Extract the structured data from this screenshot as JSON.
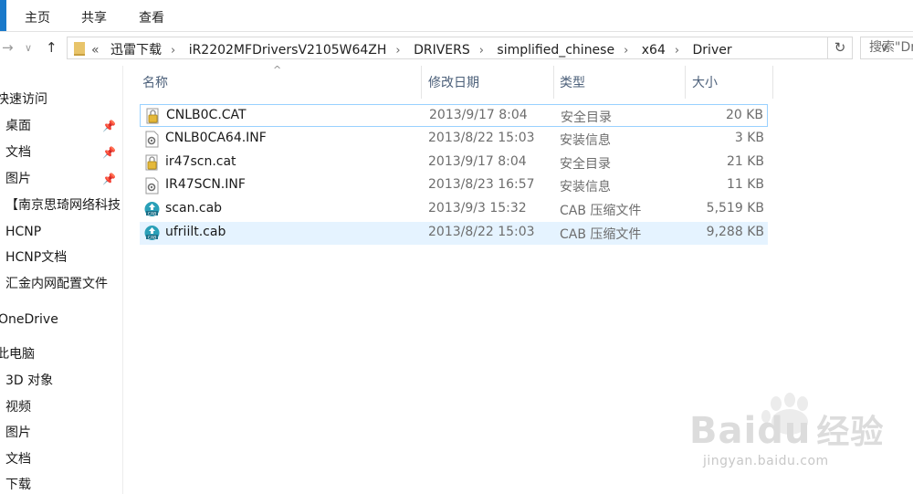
{
  "ribbon": {
    "tabs": [
      "主页",
      "共享",
      "查看"
    ]
  },
  "addressbar": {
    "back_icon": "back-arrow-icon",
    "forward_icon": "forward-arrow-icon",
    "up_icon": "up-arrow-icon",
    "overflow": "«",
    "crumbs": [
      "迅雷下载",
      "iR2202MFDriversV2105W64ZH",
      "DRIVERS",
      "simplified_chinese",
      "x64",
      "Driver"
    ],
    "search_placeholder": "搜索\"Driver\""
  },
  "sidebar": {
    "items": [
      {
        "label": "快速访问",
        "pinned": false
      },
      {
        "label": "桌面",
        "pinned": true
      },
      {
        "label": "文档",
        "pinned": true
      },
      {
        "label": "图片",
        "pinned": true
      },
      {
        "label": "【南京思琦网络科技",
        "pinned": false
      },
      {
        "label": "HCNP",
        "pinned": false
      },
      {
        "label": "HCNP文档",
        "pinned": false
      },
      {
        "label": "汇金内网配置文件",
        "pinned": false
      },
      {
        "label": "OneDrive",
        "pinned": false
      },
      {
        "label": "此电脑",
        "pinned": false
      },
      {
        "label": "3D 对象",
        "pinned": false
      },
      {
        "label": "视频",
        "pinned": false
      },
      {
        "label": "图片",
        "pinned": false
      },
      {
        "label": "文档",
        "pinned": false
      },
      {
        "label": "下载",
        "pinned": false
      }
    ]
  },
  "filelist": {
    "columns": [
      "名称",
      "修改日期",
      "类型",
      "大小"
    ],
    "sort_indicator": "^",
    "rows": [
      {
        "name": "CNLB0C.CAT",
        "date": "2013/9/17 8:04",
        "type": "安全目录",
        "size": "20 KB",
        "icon": "security-catalog-icon",
        "state": "focus"
      },
      {
        "name": "CNLB0CA64.INF",
        "date": "2013/8/22 15:03",
        "type": "安装信息",
        "size": "3 KB",
        "icon": "setup-info-icon",
        "state": ""
      },
      {
        "name": "ir47scn.cat",
        "date": "2013/9/17 8:04",
        "type": "安全目录",
        "size": "21 KB",
        "icon": "security-catalog-icon",
        "state": ""
      },
      {
        "name": "IR47SCN.INF",
        "date": "2013/8/23 16:57",
        "type": "安装信息",
        "size": "11 KB",
        "icon": "setup-info-icon",
        "state": ""
      },
      {
        "name": "scan.cab",
        "date": "2013/9/3 15:32",
        "type": "CAB 压缩文件",
        "size": "5,519 KB",
        "icon": "cab-archive-icon",
        "state": ""
      },
      {
        "name": "ufriilt.cab",
        "date": "2013/8/22 15:03",
        "type": "CAB 压缩文件",
        "size": "9,288 KB",
        "icon": "cab-archive-icon",
        "state": "hover"
      }
    ]
  },
  "watermark": {
    "brand": "Baidu",
    "product": "经验",
    "url": "jingyan.baidu.com"
  },
  "colors": {
    "accent": "#1979ca",
    "hover_row": "#e5f3ff",
    "focus_border": "#99d1ff",
    "header_text": "#4c607a"
  }
}
